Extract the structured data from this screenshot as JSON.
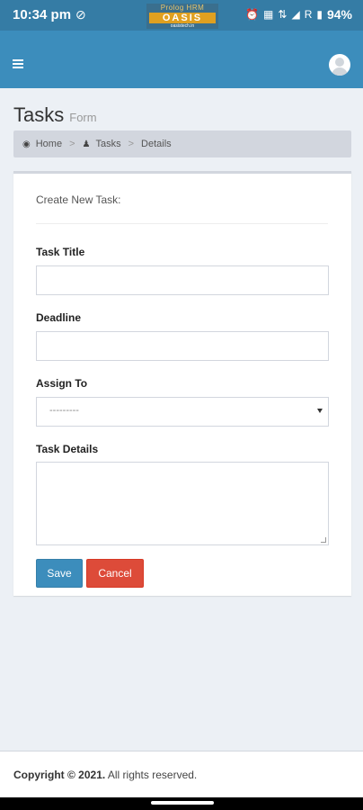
{
  "status_bar": {
    "time": "10:34 pm",
    "brand_line1": "Prolog HRM",
    "brand_line2": "OASIS",
    "brand_line3": "oasistech.in",
    "network": "R",
    "battery": "94%"
  },
  "header": {
    "menu_icon": "hamburger-icon",
    "avatar_icon": "user-avatar-icon"
  },
  "page": {
    "title": "Tasks",
    "subtitle": "Form"
  },
  "breadcrumb": {
    "home": "Home",
    "tasks": "Tasks",
    "details": "Details",
    "separator": ">"
  },
  "form": {
    "heading": "Create New Task:",
    "task_title_label": "Task Title",
    "task_title_value": "",
    "deadline_label": "Deadline",
    "deadline_value": "",
    "assign_to_label": "Assign To",
    "assign_to_selected": "---------",
    "task_details_label": "Task Details",
    "task_details_value": "",
    "save_label": "Save",
    "cancel_label": "Cancel"
  },
  "footer": {
    "copyright_bold": "Copyright © 2021.",
    "rights": "All rights reserved."
  },
  "colors": {
    "primary": "#3c8dbc",
    "danger": "#dd4b39",
    "background": "#ecf0f5"
  }
}
